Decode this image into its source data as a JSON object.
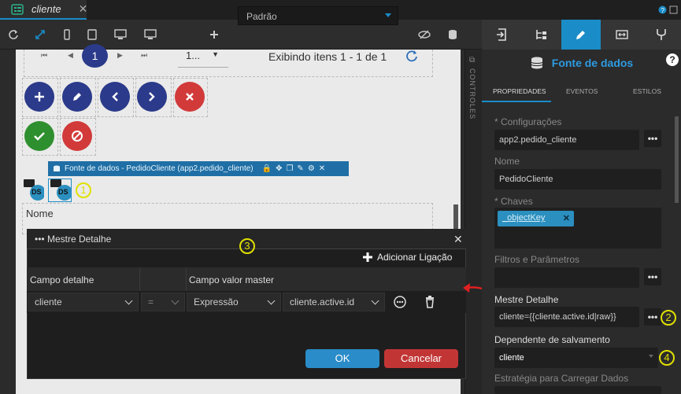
{
  "tab": {
    "title": "cliente",
    "close": "✕"
  },
  "toolbar": {
    "device_select": "Padrão"
  },
  "canvas": {
    "pager": {
      "page": "1",
      "page_size": "1...",
      "info": "Exibindo itens 1 - 1 de 1"
    },
    "datasource_bar": "Fonte de dados - PedidoCliente (app2.pedido_cliente)",
    "ds_label": "DS",
    "nome_label": "Nome",
    "controls_label": "CONTROLES"
  },
  "dialog": {
    "title": "Mestre Detalhe",
    "add_link": "Adicionar Ligação",
    "columns": [
      "Campo detalhe",
      "Campo valor master"
    ],
    "row": {
      "detail_field": "cliente",
      "operator": "=",
      "value_type": "Expressão",
      "value": "cliente.active.id"
    },
    "ok": "OK",
    "cancel": "Cancelar"
  },
  "right_panel": {
    "title": "Fonte de dados",
    "help": "?",
    "subtabs": [
      "PROPRIEDADES",
      "EVENTOS",
      "ESTILOS"
    ],
    "fields": {
      "config_label": "* Configurações",
      "config_value": "app2.pedido_cliente",
      "nome_label": "Nome",
      "nome_value": "PedidoCliente",
      "chaves_label": "* Chaves",
      "chaves_chip": "_objectKey",
      "filtros_label": "Filtros e Parâmetros",
      "mestre_label": "Mestre Detalhe",
      "mestre_value": "cliente={{cliente.active.id|raw}}",
      "dependente_label": "Dependente de salvamento",
      "dependente_value": "cliente",
      "estrategia_label": "Estratégia para Carregar Dados"
    }
  },
  "annotations": [
    "1",
    "2",
    "3",
    "4"
  ],
  "colors": {
    "accent": "#1a8cc8",
    "annotation": "#e0e000",
    "arrow": "#e02020"
  }
}
